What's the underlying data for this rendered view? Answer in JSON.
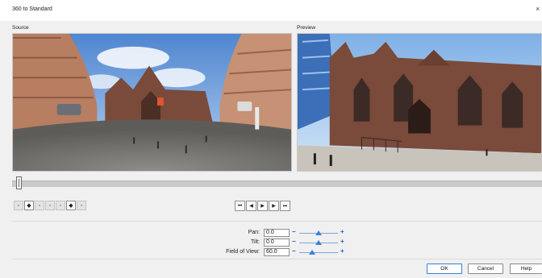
{
  "window": {
    "title": "360 to Standard",
    "close_glyph": "×"
  },
  "panes": {
    "source_label": "Source",
    "preview_label": "Preview"
  },
  "timeline": {
    "position": 0.0
  },
  "toolbar": {
    "icons": [
      "tool-a-icon",
      "tool-b-icon",
      "tool-c-icon",
      "tool-d-icon",
      "tool-e-icon",
      "tool-f-icon",
      "tool-g-icon"
    ]
  },
  "transport": {
    "first": "⏮",
    "prev": "◀",
    "play": "▶",
    "next": "▶",
    "last": "⏭"
  },
  "params": {
    "pan": {
      "label": "Pan:",
      "value": "0.0",
      "level": 0.5
    },
    "tilt": {
      "label": "Tilt:",
      "value": "0.0",
      "level": 0.5
    },
    "fov": {
      "label": "Field of View:",
      "value": "60.0",
      "level": 0.33
    }
  },
  "buttons": {
    "ok": "OK",
    "cancel": "Cancel",
    "help": "Help"
  },
  "colors": {
    "accent": "#3d7fd6",
    "sky": "#6fa3df",
    "brick": "#7a4a3a"
  }
}
